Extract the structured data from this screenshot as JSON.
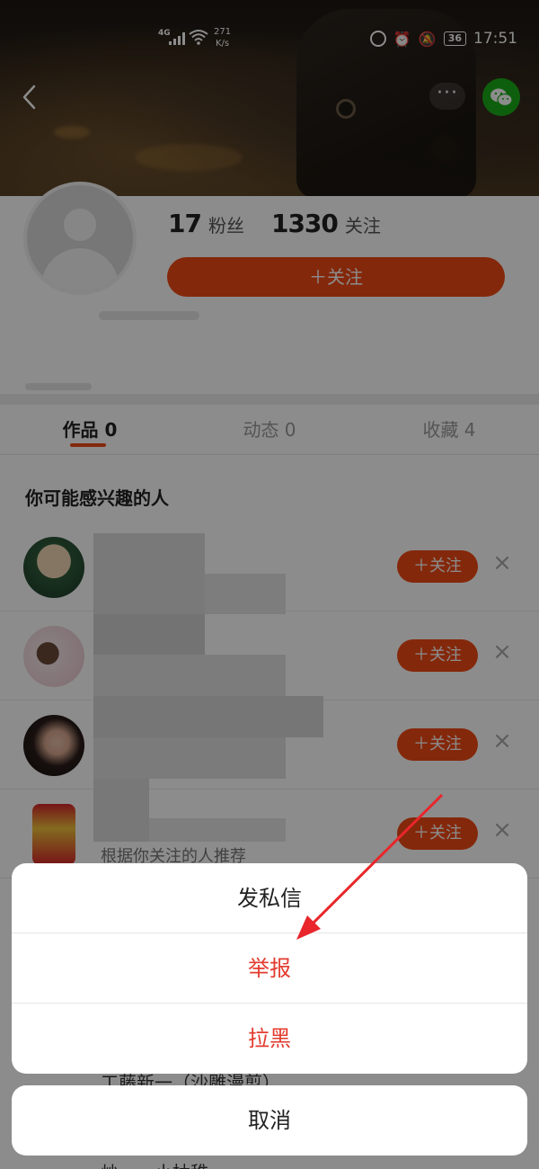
{
  "status_bar": {
    "network": "4G",
    "speed_value": "271",
    "speed_unit": "K/s",
    "battery": "36",
    "time": "17:51"
  },
  "nav": {
    "more_label": "···"
  },
  "profile": {
    "fans_count": "17",
    "fans_label": "粉丝",
    "following_count": "1330",
    "following_label": "关注",
    "follow_button": "＋关注"
  },
  "tabs": [
    {
      "label": "作品 0",
      "active": true
    },
    {
      "label": "动态 0",
      "active": false
    },
    {
      "label": "收藏 4",
      "active": false
    }
  ],
  "recommend": {
    "title": "你可能感兴趣的人",
    "follow_label": "＋关注",
    "close_label": "×",
    "subtitle": "根据你关注的人推荐",
    "partial_name_1": "工藤新一（沙雕漫剪）",
    "partial_name_2": "炒……小抽稚"
  },
  "action_sheet": {
    "items": [
      "发私信",
      "举报",
      "拉黑"
    ],
    "cancel": "取消"
  },
  "colors": {
    "accent": "#f04a14",
    "danger": "#e33b2e",
    "arrow": "#e8262b"
  }
}
